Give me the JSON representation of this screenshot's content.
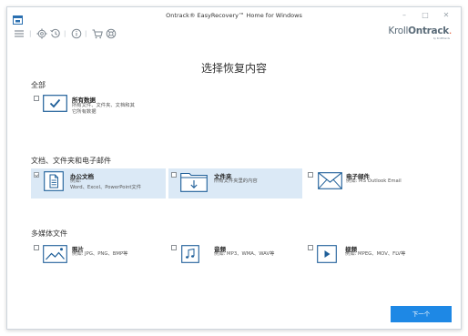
{
  "window": {
    "title": "Ontrack® EasyRecovery™ Home for Windows",
    "minimize": "–",
    "maximize": "□",
    "close": "✕"
  },
  "toolbar": {
    "brand_light": "Kroll",
    "brand_bold": "Ontrack",
    "brand_dot": ".",
    "brand_sub": "by KrollBrands"
  },
  "page_title": "选择恢复内容",
  "sections": {
    "all": {
      "title": "全部",
      "option": {
        "title": "所有数据",
        "desc_line1": "所有文件、文件夹、文档和其",
        "desc_line2": "它所有数据"
      }
    },
    "docs": {
      "title": "文档、文件夹和电子邮件",
      "office": {
        "title": "办公文档",
        "desc_line1": "例如:",
        "desc_line2": "Word、Excel、PowerPoint文件"
      },
      "folders": {
        "title": "文件夹",
        "desc_line1": "所有文件夹里的内容"
      },
      "email": {
        "title": "电子邮件",
        "desc_line1": "例如: MS Outlook Email"
      }
    },
    "media": {
      "title": "多媒体文件",
      "photos": {
        "title": "照片",
        "desc_line1": "例如: JPG、PNG、BMP等"
      },
      "audio": {
        "title": "音频",
        "desc_line1": "例如: MP3、WMA、WAV等"
      },
      "video": {
        "title": "视频",
        "desc_line1": "例如: MPEG、MOV、FLV等"
      }
    }
  },
  "next_button": "下一个",
  "colors": {
    "accent": "#1e88e5",
    "selected_bg": "#dbe9f6",
    "icon_blue": "#1f5f99"
  }
}
